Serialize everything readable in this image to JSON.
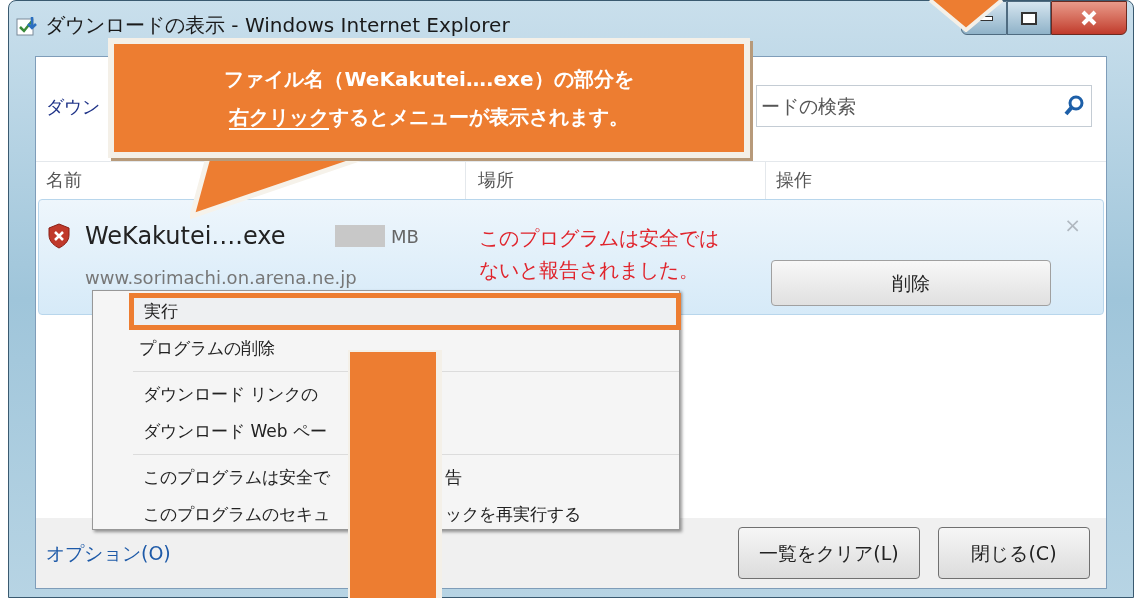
{
  "window": {
    "title": "ダウンロードの表示 - Windows Internet Explorer"
  },
  "toolbar": {
    "label": "ダウン",
    "search": {
      "placeholder": "ードの検索"
    }
  },
  "columns": [
    "名前",
    "場所",
    "操作"
  ],
  "downloads": [
    {
      "file_name": "WeKakutei….exe",
      "size_unit": "MB",
      "source": "www.sorimachi.on.arena.ne.jp",
      "warning_lines": [
        "このプログラムは安全では",
        "ないと報告されました。"
      ],
      "action": "削除",
      "dismiss": "×"
    }
  ],
  "context_menu": [
    [
      {
        "label": "実行",
        "selected": true
      },
      {
        "label": "プログラムの削除",
        "selected": false
      }
    ],
    [
      {
        "label": "ダウンロード リンクの",
        "selected": false
      },
      {
        "label": "ダウンロード Web ペー",
        "selected": false
      }
    ],
    [
      {
        "label": "このプログラムは安全で",
        "label_after": "告",
        "selected": false
      },
      {
        "label": "このプログラムのセキュ",
        "label_after": "ックを再実行する",
        "selected": false
      }
    ]
  ],
  "footer": {
    "options_link": "オプション(O)",
    "buttons": [
      "一覧をクリア(L)",
      "閉じる(C)"
    ]
  },
  "callout": {
    "line1": "ファイル名（WeKakutei….exe）の部分を",
    "line2_underlined": "右クリック",
    "line2_rest": "するとメニューが表示されます。"
  }
}
